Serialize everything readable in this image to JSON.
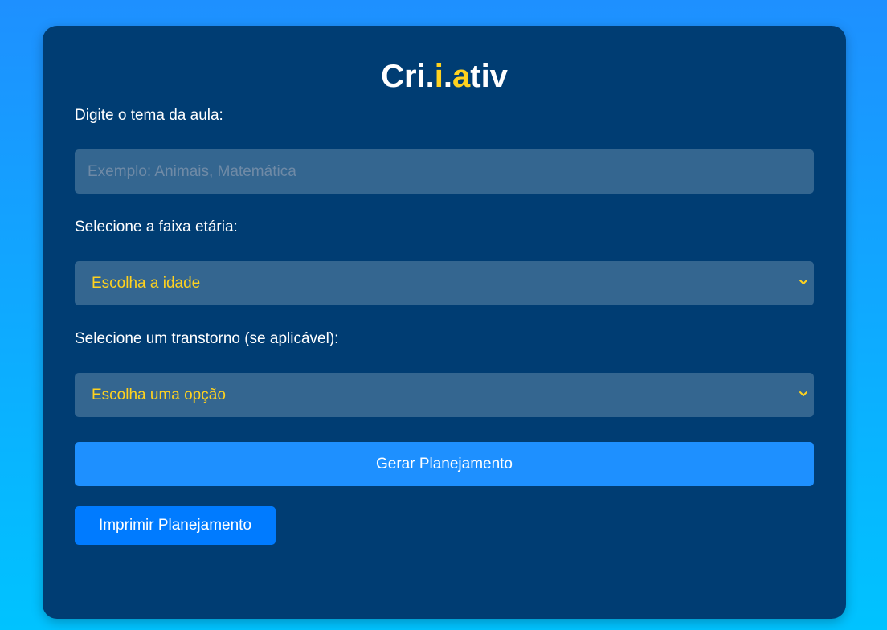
{
  "app": {
    "title_parts": [
      "Cri.",
      "i",
      ".",
      "a",
      "tiv"
    ]
  },
  "form": {
    "theme_label": "Digite o tema da aula:",
    "theme_value": "",
    "theme_placeholder": "Exemplo: Animais, Matemática",
    "age_label": "Selecione a faixa etária:",
    "age_selected": "Escolha a idade",
    "disorder_label": "Selecione um transtorno (se aplicável):",
    "disorder_selected": "Escolha uma opção"
  },
  "buttons": {
    "generate": "Gerar Planejamento",
    "print": "Imprimir Planejamento"
  },
  "colors": {
    "background_top": "#1e90ff",
    "background_bottom": "#00c3ff",
    "card": "#003d73",
    "accent": "#ffd21f",
    "field": "#346690",
    "generate_button": "#1e90ff",
    "print_button": "#007bff"
  },
  "icons": {
    "select_chevron": "chevron-down-icon"
  }
}
